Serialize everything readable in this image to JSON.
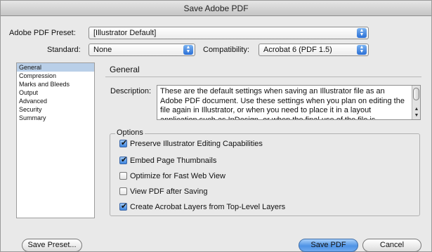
{
  "window": {
    "title": "Save Adobe PDF"
  },
  "preset": {
    "label": "Adobe PDF Preset:",
    "value": "[Illustrator Default]"
  },
  "standard": {
    "label": "Standard:",
    "value": "None"
  },
  "compatibility": {
    "label": "Compatibility:",
    "value": "Acrobat 6 (PDF 1.5)"
  },
  "sidebar": {
    "items": [
      "General",
      "Compression",
      "Marks and Bleeds",
      "Output",
      "Advanced",
      "Security",
      "Summary"
    ],
    "selected": "General"
  },
  "panel": {
    "title": "General",
    "description_label": "Description:",
    "description_text": "These are the default settings when saving an Illustrator file as an Adobe PDF document. Use these settings when you plan on editing the file again in Illustrator, or when you need to place it in a layout application such as InDesign, or when the final use of the file is"
  },
  "options": {
    "legend": "Options",
    "items": [
      {
        "label": "Preserve Illustrator Editing Capabilities",
        "checked": true
      },
      {
        "label": "Embed Page Thumbnails",
        "checked": true
      },
      {
        "label": "Optimize for Fast Web View",
        "checked": false
      },
      {
        "label": "View PDF after Saving",
        "checked": false
      },
      {
        "label": "Create Acrobat Layers from Top-Level Layers",
        "checked": true
      }
    ]
  },
  "buttons": {
    "save_preset": "Save Preset...",
    "save_pdf": "Save PDF",
    "cancel": "Cancel"
  }
}
